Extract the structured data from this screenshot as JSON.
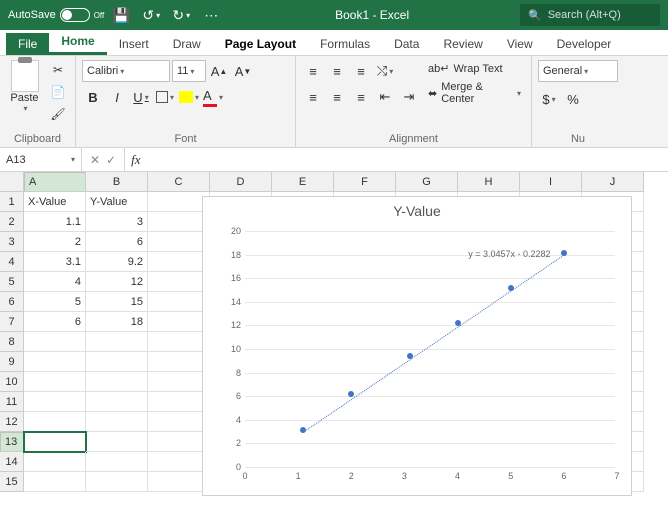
{
  "title_bar": {
    "autosave_label": "AutoSave",
    "autosave_state": "Off",
    "doc_title": "Book1 - Excel",
    "search_placeholder": "Search (Alt+Q)"
  },
  "tabs": {
    "file": "File",
    "items": [
      "Home",
      "Insert",
      "Draw",
      "Page Layout",
      "Formulas",
      "Data",
      "Review",
      "View",
      "Developer"
    ],
    "active": "Home",
    "alt_active": "Page Layout"
  },
  "ribbon": {
    "clipboard": {
      "label": "Clipboard",
      "paste": "Paste"
    },
    "font": {
      "label": "Font",
      "name": "Calibri",
      "size": "11",
      "bold": "B",
      "italic": "I",
      "underline": "U"
    },
    "alignment": {
      "label": "Alignment",
      "wrap": "Wrap Text",
      "merge": "Merge & Center"
    },
    "number": {
      "label": "Nu",
      "format": "General",
      "currency": "$"
    }
  },
  "name_box": "A13",
  "fx_label": "fx",
  "columns": [
    "A",
    "B",
    "C",
    "D",
    "E",
    "F",
    "G",
    "H",
    "I",
    "J"
  ],
  "rows": [
    "1",
    "2",
    "3",
    "4",
    "5",
    "6",
    "7",
    "8",
    "9",
    "10",
    "11",
    "12",
    "13",
    "14",
    "15"
  ],
  "sheet": {
    "headers": [
      "X-Value",
      "Y-Value"
    ],
    "data": [
      [
        "1.1",
        "3"
      ],
      [
        "2",
        "6"
      ],
      [
        "3.1",
        "9.2"
      ],
      [
        "4",
        "12"
      ],
      [
        "5",
        "15"
      ],
      [
        "6",
        "18"
      ]
    ]
  },
  "chart_data": {
    "type": "scatter",
    "title": "Y-Value",
    "xlabel": "",
    "ylabel": "",
    "xlim": [
      0,
      7
    ],
    "ylim": [
      0,
      20
    ],
    "xticks": [
      0,
      1,
      2,
      3,
      4,
      5,
      6,
      7
    ],
    "yticks": [
      0,
      2,
      4,
      6,
      8,
      10,
      12,
      14,
      16,
      18,
      20
    ],
    "series": [
      {
        "name": "Y-Value",
        "x": [
          1.1,
          2,
          3.1,
          4,
          5,
          6
        ],
        "y": [
          3,
          6,
          9.2,
          12,
          15,
          18
        ]
      }
    ],
    "trendline": {
      "equation": "y = 3.0457x - 0.2282",
      "type": "linear"
    }
  }
}
